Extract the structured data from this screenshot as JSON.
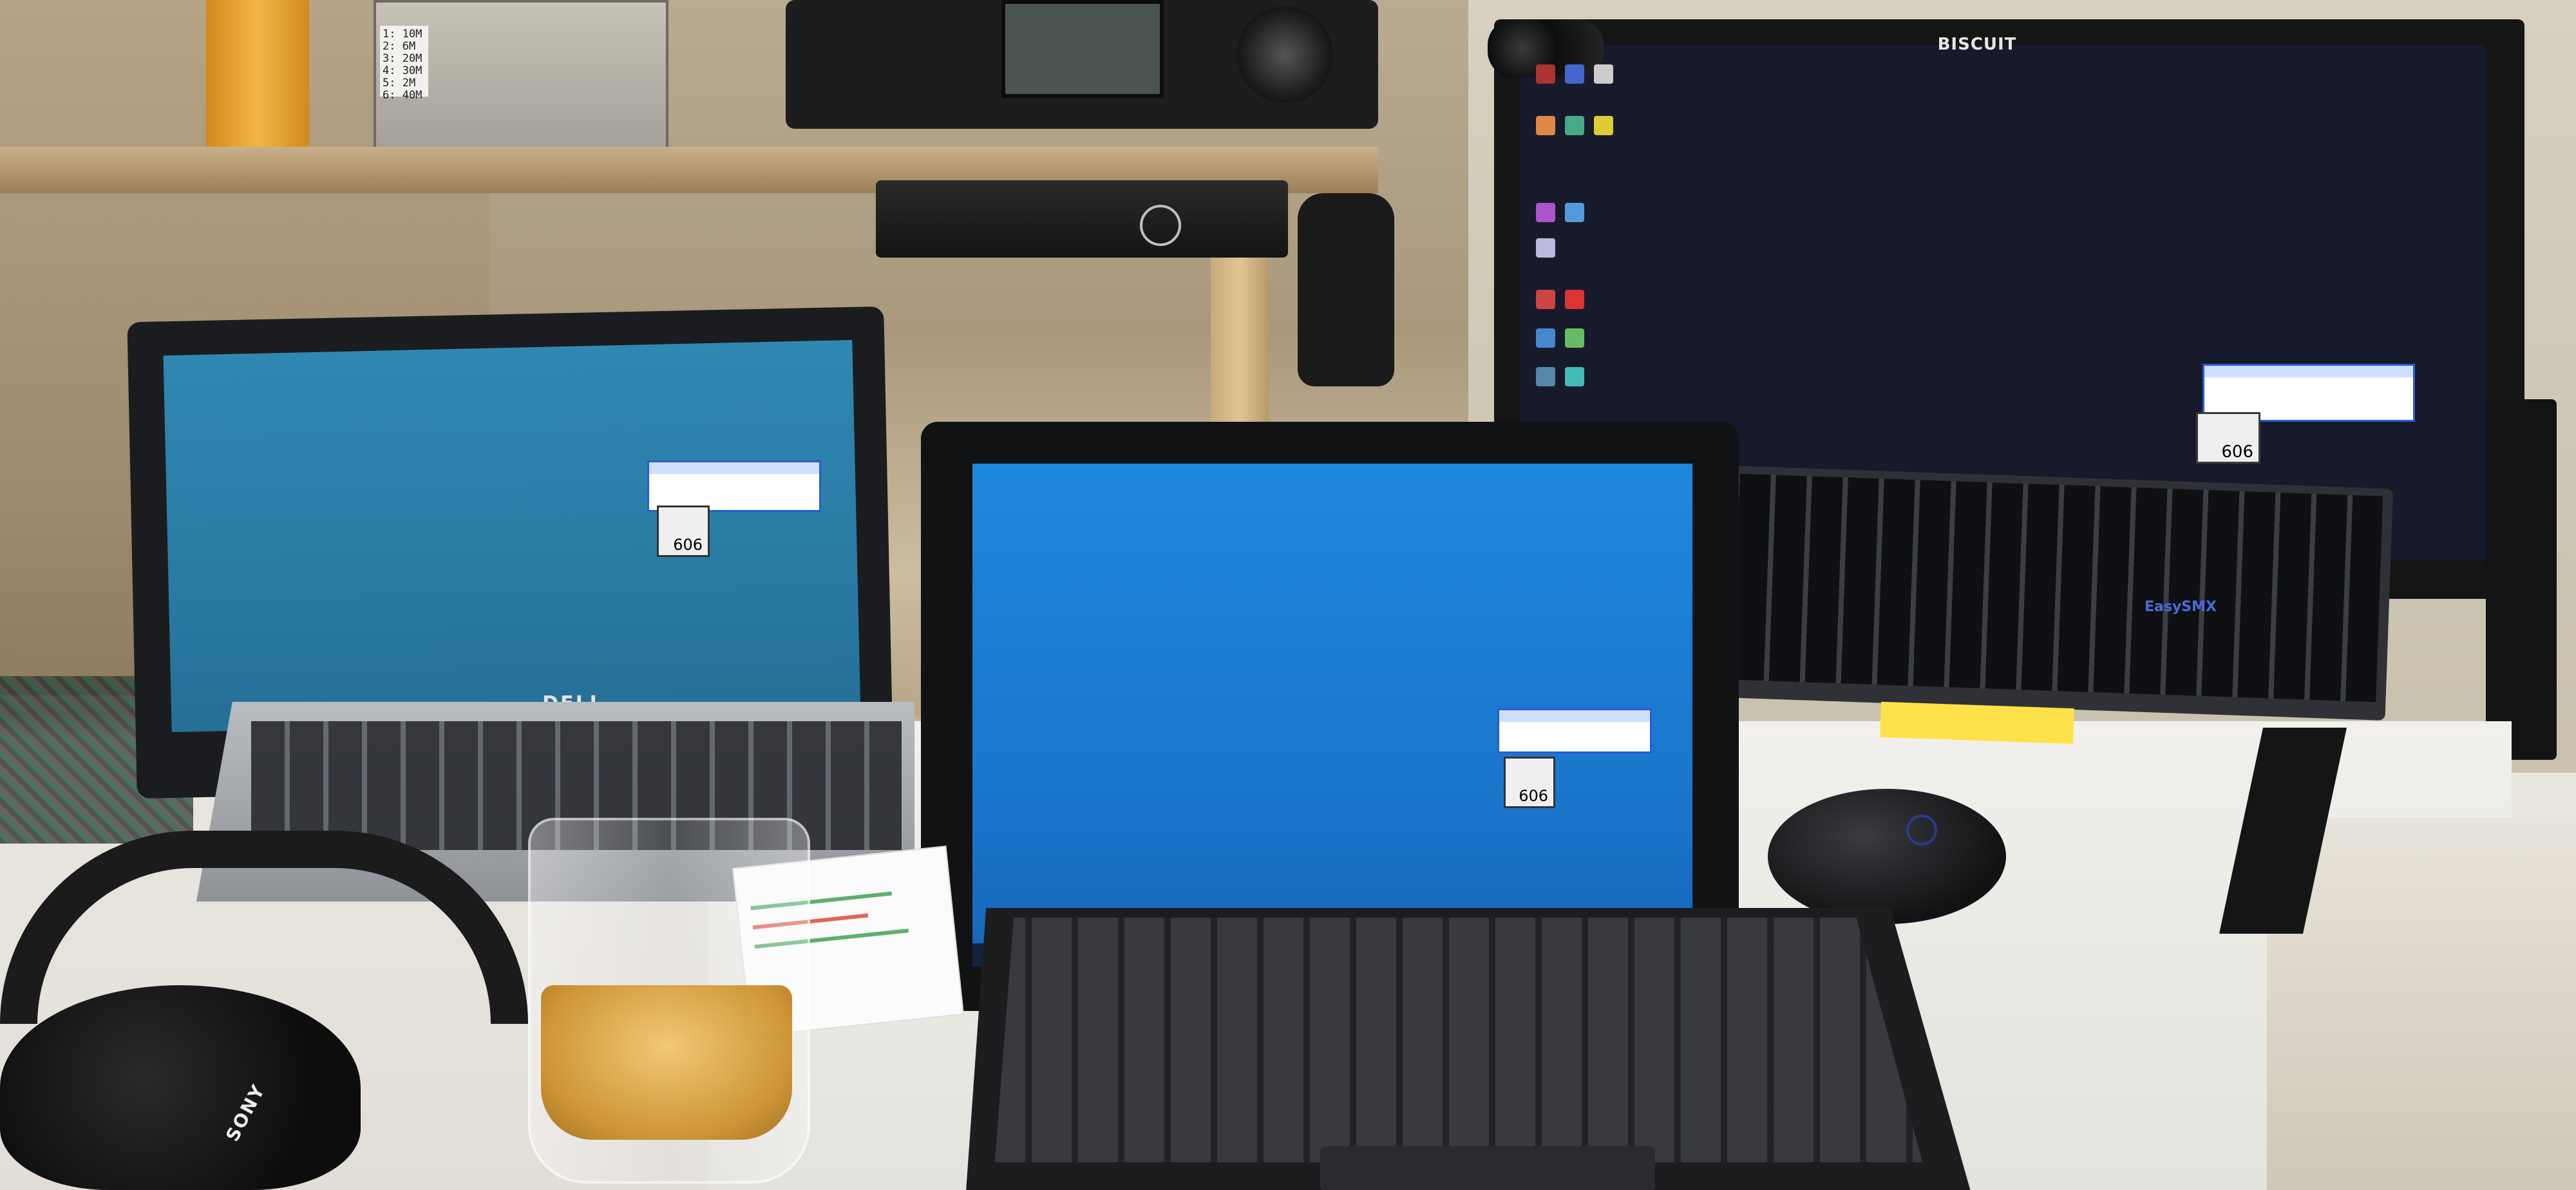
{
  "scene": {
    "description_labels": {
      "monitor_brand": "BISCUIT",
      "laptop_brand": "DELL",
      "keyboard_brand": "EasySMX",
      "headphone_brand": "SONY"
    },
    "psu_label": [
      "1: 10M",
      "2: 6M",
      "3: 20M",
      "4: 30M",
      "5: 2M",
      "6: 40M"
    ],
    "colors": {
      "monitor_desktop": "#171a2b",
      "laptop_desktop": "#2a7aa3",
      "tablet_desktop": "#1974c9",
      "widget_border": "#2a5bd7",
      "whiskey": "#c98b22",
      "mouse_logo": "#2a3b8f"
    }
  },
  "widgets": {
    "monitor_value": "606",
    "laptop_value": "606",
    "tablet_value": "606"
  }
}
